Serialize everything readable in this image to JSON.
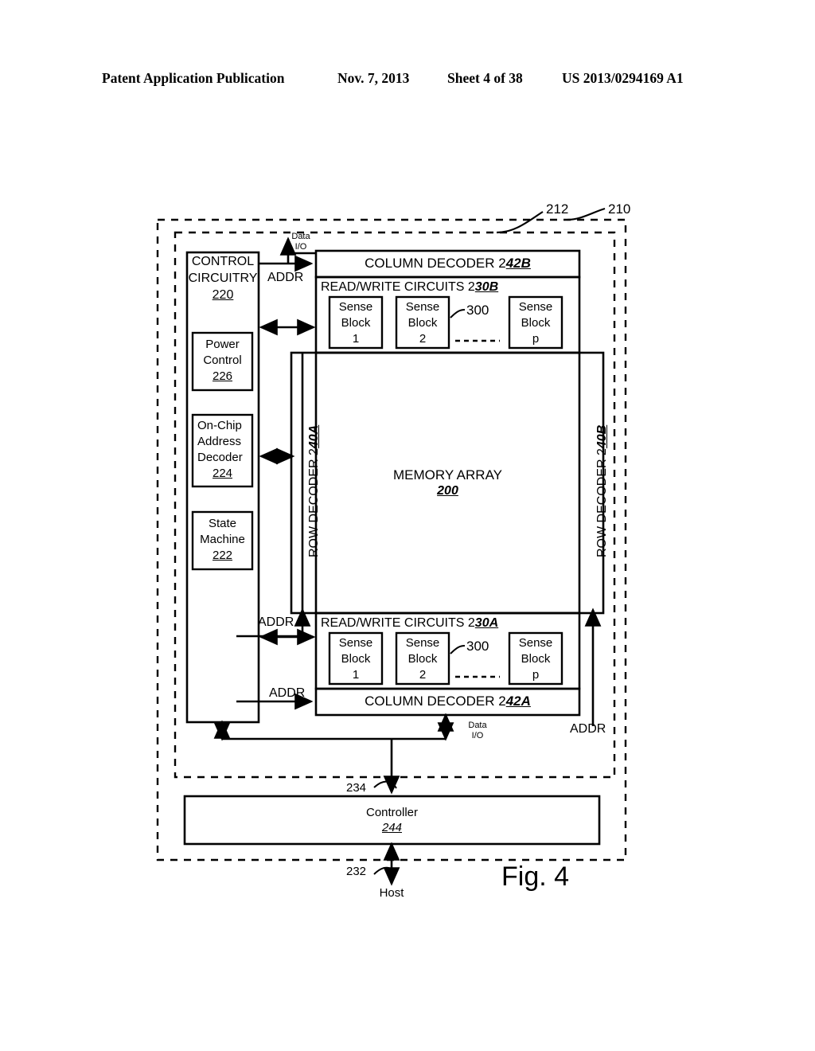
{
  "header": {
    "publication": "Patent Application Publication",
    "date": "Nov. 7, 2013",
    "sheet": "Sheet 4 of 38",
    "number": "US 2013/0294169 A1"
  },
  "figure": {
    "caption": "Fig. 4",
    "outer_ref": "210",
    "inner_ref": "212",
    "control_circuitry": {
      "line1": "CONTROL",
      "line2": "CIRCUITRY",
      "ref": "220",
      "blocks": [
        {
          "line1": "Power",
          "line2": "Control",
          "ref": "226"
        },
        {
          "line1": "On-Chip",
          "line2": "Address",
          "line3": "Decoder",
          "ref": "224"
        },
        {
          "line1": "State",
          "line2": "Machine",
          "ref": "222"
        }
      ]
    },
    "column_decoder_top": {
      "label": "COLUMN DECODER 2",
      "ref": "42B"
    },
    "column_decoder_bottom": {
      "label": "COLUMN DECODER 2",
      "ref": "42A"
    },
    "read_write_top": {
      "label": "READ/WRITE CIRCUITS 2",
      "ref": "30B"
    },
    "read_write_bottom": {
      "label": "READ/WRITE CIRCUITS 2",
      "ref": "30A"
    },
    "sense_blocks": [
      {
        "line1": "Sense",
        "line2": "Block",
        "index": "1"
      },
      {
        "line1": "Sense",
        "line2": "Block",
        "index": "2"
      },
      {
        "line1": "Sense",
        "line2": "Block",
        "index": "p"
      }
    ],
    "sense_block_ref": "300",
    "sense_ellipsis": "---------",
    "memory_array": {
      "label": "MEMORY ARRAY",
      "ref": "200"
    },
    "row_decoder_left": {
      "label": "ROW DECODER 2",
      "ref": "40A"
    },
    "row_decoder_right": {
      "label": "ROW DECODER 2",
      "ref": "40B"
    },
    "addr_labels": {
      "top": "ADDR",
      "mid_left": "ADDR",
      "bottom_left": "ADDR",
      "right": "ADDR"
    },
    "data_io_top": {
      "line1": "Data",
      "line2": "I/O"
    },
    "data_io_bottom": {
      "line1": "Data",
      "line2": "I/O"
    },
    "controller": {
      "label": "Controller",
      "ref": "244"
    },
    "controller_bus_ref": "234",
    "host_bus_ref": "232",
    "host": "Host"
  }
}
